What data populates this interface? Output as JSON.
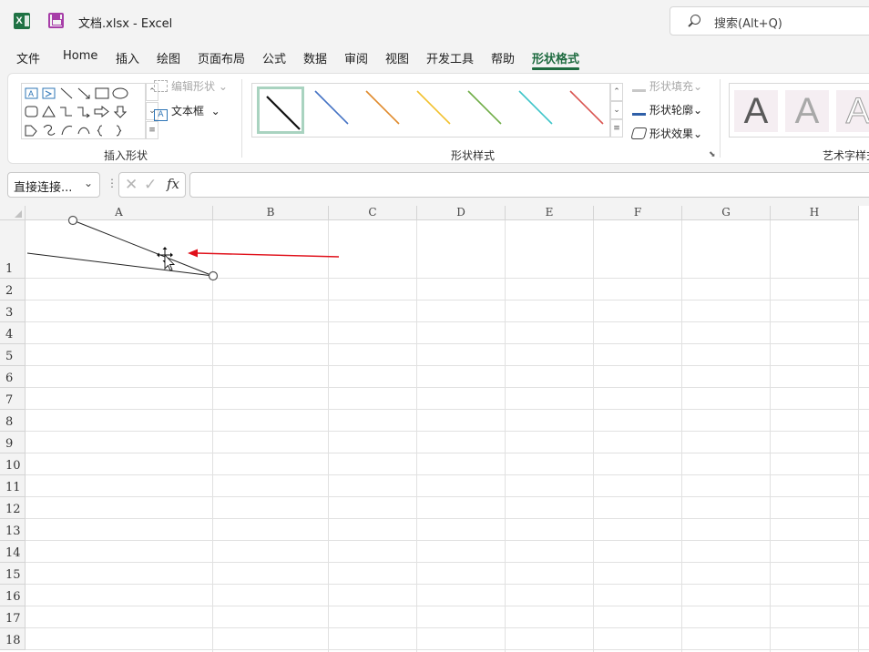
{
  "title_bar": {
    "document_title": "文档.xlsx  -  Excel",
    "search_placeholder": "搜索(Alt+Q)",
    "app_icon": "excel-icon",
    "save_icon": "save-icon"
  },
  "tabs": [
    {
      "label": "文件"
    },
    {
      "label": "Home"
    },
    {
      "label": "插入"
    },
    {
      "label": "绘图"
    },
    {
      "label": "页面布局"
    },
    {
      "label": "公式"
    },
    {
      "label": "数据"
    },
    {
      "label": "审阅"
    },
    {
      "label": "视图"
    },
    {
      "label": "开发工具"
    },
    {
      "label": "帮助"
    },
    {
      "label": "形状格式",
      "active": true
    }
  ],
  "ribbon": {
    "insert_shapes": {
      "edit_shape_label": "编辑形状",
      "text_box_label": "文本框",
      "group_label": "插入形状"
    },
    "shape_styles": {
      "group_label": "形状样式",
      "line_colors": [
        "#111111",
        "#4472c4",
        "#e08a2c",
        "#f2c12e",
        "#70ad47",
        "#3ec5c9",
        "#d9534f"
      ],
      "fill_label": "形状填充",
      "outline_label": "形状轮廓",
      "effects_label": "形状效果"
    },
    "wordart": {
      "group_label": "艺术字样式",
      "sample_letter": "A"
    }
  },
  "formula_bar": {
    "name_box_value": "直接连接...",
    "fx_label": "fx",
    "formula_value": ""
  },
  "sheet": {
    "columns": [
      "A",
      "B",
      "C",
      "D",
      "E",
      "F",
      "G",
      "H"
    ],
    "rows": [
      "1",
      "2",
      "3",
      "4",
      "5",
      "6",
      "7",
      "8",
      "9",
      "10",
      "11",
      "12",
      "13",
      "14",
      "15",
      "16",
      "17",
      "18"
    ],
    "annotation_arrow_color": "#e0101a"
  }
}
